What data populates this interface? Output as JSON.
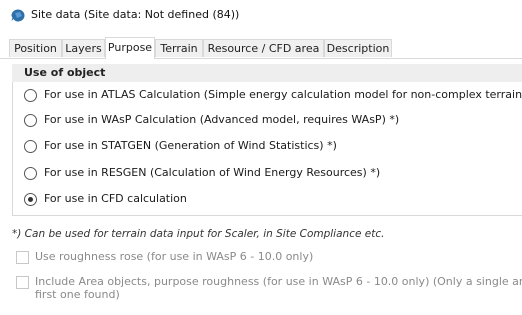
{
  "window": {
    "title": "Site data  (Site data: Not defined (84))",
    "icon": "app-logo-icon"
  },
  "tabs": [
    {
      "label": "Position",
      "active": false
    },
    {
      "label": "Layers",
      "active": false
    },
    {
      "label": "Purpose",
      "active": true
    },
    {
      "label": "Terrain",
      "active": false
    },
    {
      "label": "Resource / CFD area",
      "active": false
    },
    {
      "label": "Description",
      "active": false
    }
  ],
  "purpose": {
    "group_title": "Use of object",
    "options": [
      {
        "label": "For use in ATLAS Calculation (Simple energy calculation model for non-complex terrain)",
        "selected": false
      },
      {
        "label": "For use in WAsP Calculation (Advanced model, requires WAsP) *)",
        "selected": false
      },
      {
        "label": "For use in STATGEN (Generation of Wind Statistics) *)",
        "selected": false
      },
      {
        "label": "For use in RESGEN (Calculation of Wind Energy Resources) *)",
        "selected": false
      },
      {
        "label": "For use in CFD calculation",
        "selected": true
      }
    ],
    "note": "*) Can be used for terrain data input for Scaler, in Site Compliance etc.",
    "checkboxes": [
      {
        "label": "Use roughness rose (for use in WAsP 6 - 10.0 only)",
        "checked": false,
        "enabled": false
      },
      {
        "label_line1": "Include Area objects, purpose roughness (for use in WAsP 6 - 10.0 only) (Only a single area",
        "label_line2": "first one found)",
        "checked": false,
        "enabled": false
      }
    ]
  },
  "colors": {
    "icon_blue": "#2f6fa8",
    "tab_border": "#d9d9d9",
    "group_header_bg": "#eeeeee",
    "disabled_text": "#8a8a8a"
  }
}
